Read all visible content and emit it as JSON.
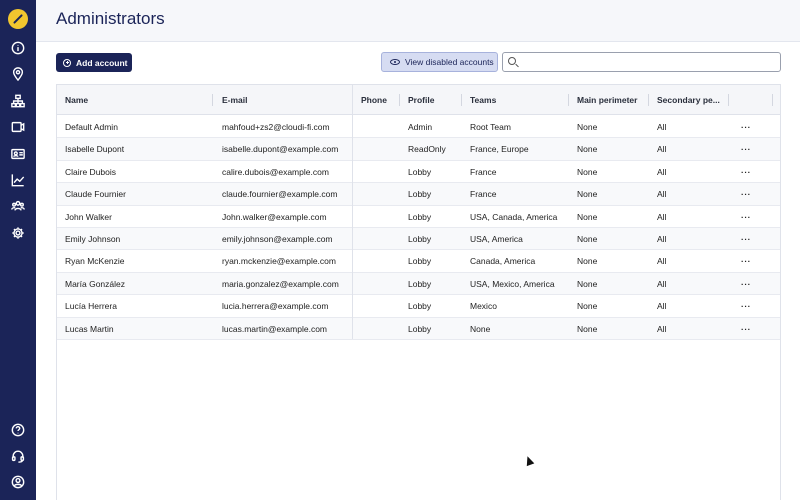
{
  "page": {
    "title": "Administrators"
  },
  "sidebar": {
    "icons": [
      {
        "name": "info-icon"
      },
      {
        "name": "location-pin-icon"
      },
      {
        "name": "network-icon"
      },
      {
        "name": "display-icon"
      },
      {
        "name": "id-card-icon"
      },
      {
        "name": "chart-icon"
      },
      {
        "name": "users-icon"
      },
      {
        "name": "gear-icon"
      }
    ],
    "bottom_icons": [
      {
        "name": "help-icon"
      },
      {
        "name": "headset-icon"
      },
      {
        "name": "user-profile-icon"
      }
    ]
  },
  "toolbar": {
    "add_label": "Add account",
    "view_disabled_label": "View disabled accounts",
    "search_placeholder": ""
  },
  "table": {
    "columns": [
      "Name",
      "E-mail",
      "Phone",
      "Profile",
      "Teams",
      "Main perimeter",
      "Secondary pe...",
      ""
    ],
    "rows": [
      {
        "name": "Default Admin",
        "email": "mahfoud+zs2@cloudi-fi.com",
        "phone": "",
        "profile": "Admin",
        "teams": "Root Team",
        "main": "None",
        "secondary": "All",
        "actions": "···"
      },
      {
        "name": "Isabelle Dupont",
        "email": "isabelle.dupont@example.com",
        "phone": "",
        "profile": "ReadOnly",
        "teams": "France, Europe",
        "main": "None",
        "secondary": "All",
        "actions": "···"
      },
      {
        "name": "Claire Dubois",
        "email": "calire.dubois@example.com",
        "phone": "",
        "profile": "Lobby",
        "teams": "France",
        "main": "None",
        "secondary": "All",
        "actions": "···"
      },
      {
        "name": "Claude Fournier",
        "email": "claude.fournier@example.com",
        "phone": "",
        "profile": "Lobby",
        "teams": "France",
        "main": "None",
        "secondary": "All",
        "actions": "···"
      },
      {
        "name": "John Walker",
        "email": "John.walker@example.com",
        "phone": "",
        "profile": "Lobby",
        "teams": "USA, Canada, America",
        "main": "None",
        "secondary": "All",
        "actions": "···"
      },
      {
        "name": "Emily Johnson",
        "email": "emily.johnson@example.com",
        "phone": "",
        "profile": "Lobby",
        "teams": "USA, America",
        "main": "None",
        "secondary": "All",
        "actions": "···"
      },
      {
        "name": "Ryan McKenzie",
        "email": "ryan.mckenzie@example.com",
        "phone": "",
        "profile": "Lobby",
        "teams": "Canada, America",
        "main": "None",
        "secondary": "All",
        "actions": "···"
      },
      {
        "name": "María González",
        "email": "maria.gonzalez@example.com",
        "phone": "",
        "profile": "Lobby",
        "teams": "USA, Mexico, America",
        "main": "None",
        "secondary": "All",
        "actions": "···"
      },
      {
        "name": "Lucía Herrera",
        "email": "lucia.herrera@example.com",
        "phone": "",
        "profile": "Lobby",
        "teams": "Mexico",
        "main": "None",
        "secondary": "All",
        "actions": "···"
      },
      {
        "name": "Lucas Martin",
        "email": "lucas.martin@example.com",
        "phone": "",
        "profile": "Lobby",
        "teams": "None",
        "main": "None",
        "secondary": "All",
        "actions": "···"
      }
    ]
  }
}
